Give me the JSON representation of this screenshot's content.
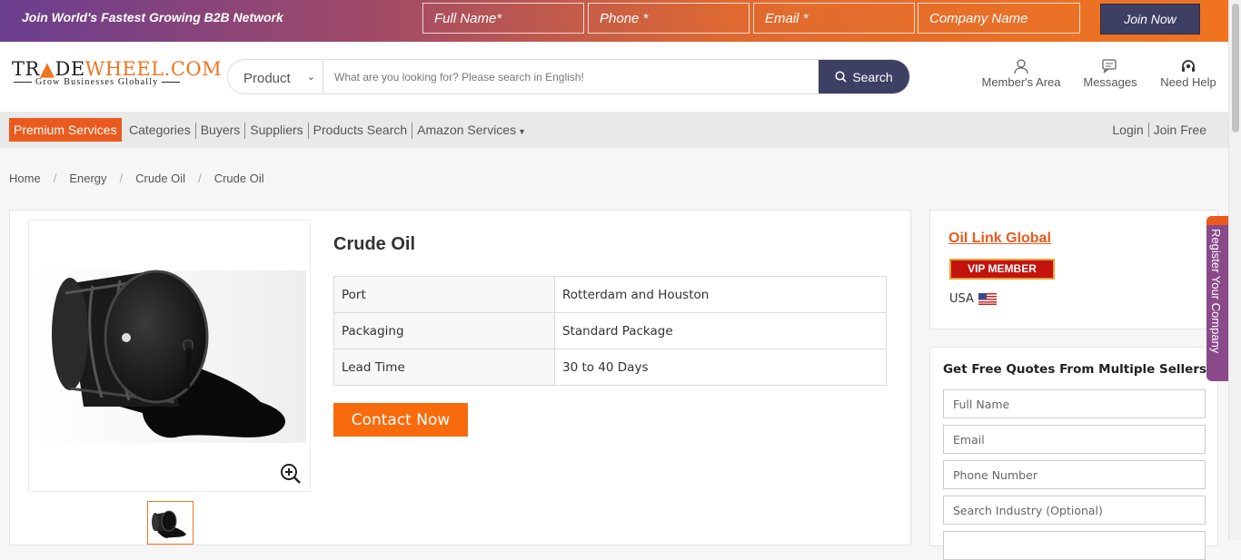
{
  "topbar": {
    "slogan": "Join World's Fastest Growing B2B Network",
    "full_name_placeholder": "Full Name*",
    "phone_placeholder": "Phone *",
    "email_placeholder": "Email *",
    "company_placeholder": "Company Name",
    "join_label": "Join Now"
  },
  "logo": {
    "pre": "TR",
    "mid": "DE",
    "post": "WHEEL",
    "tld": ".COM",
    "tagline": "Grow Businesses Globally"
  },
  "search": {
    "category": "Product",
    "placeholder": "What are you looking for? Please search in English!",
    "button": "Search"
  },
  "header_links": {
    "members": "Member's Area",
    "messages": "Messages",
    "help": "Need Help"
  },
  "nav": {
    "premium": "Premium Services",
    "items": [
      "Categories",
      "Buyers",
      "Suppliers",
      "Products Search",
      "Amazon Services"
    ],
    "login": "Login",
    "join": "Join Free"
  },
  "breadcrumb": [
    "Home",
    "Energy",
    "Crude Oil",
    "Crude Oil"
  ],
  "product": {
    "title": "Crude Oil",
    "specs": [
      {
        "key": "Port",
        "value": "Rotterdam and Houston"
      },
      {
        "key": "Packaging",
        "value": "Standard Package"
      },
      {
        "key": "Lead Time",
        "value": "30 to 40 Days"
      }
    ],
    "contact_label": "Contact Now"
  },
  "seller": {
    "name": "Oil Link Global",
    "badge": "VIP MEMBER",
    "country": "USA"
  },
  "quote_form": {
    "title": "Get Free Quotes From Multiple Sellers",
    "full_name": "Full Name",
    "email": "Email",
    "phone": "Phone Number",
    "industry": "Search Industry (Optional)"
  },
  "register_tab": "Register Your Company",
  "colors": {
    "accent": "#f07420",
    "navy": "#3d3f63",
    "vip_red": "#c4120d",
    "register_purple": "#8a4a8a"
  }
}
